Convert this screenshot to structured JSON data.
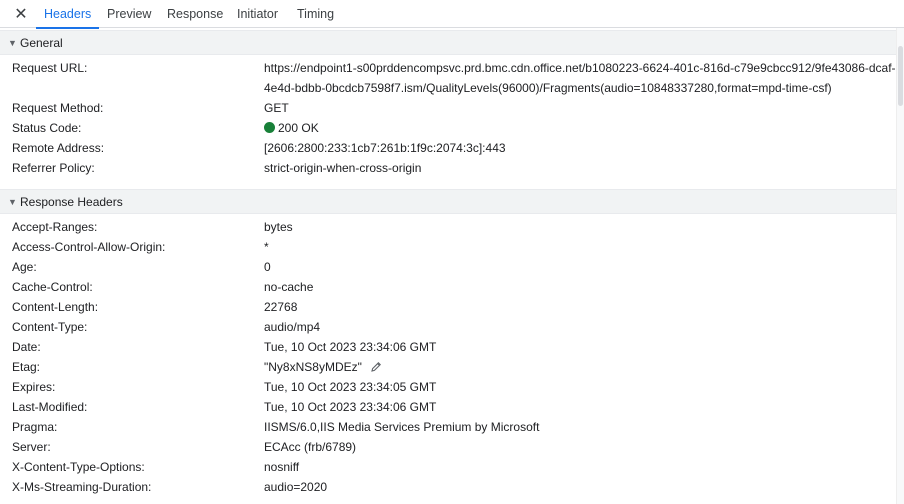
{
  "tabbar": {
    "close_icon": "close-icon",
    "tabs": [
      "Headers",
      "Preview",
      "Response",
      "Initiator",
      "Timing"
    ],
    "active_tab": "Headers"
  },
  "general": {
    "title": "General",
    "rows": [
      {
        "key": "Request URL:",
        "value": "https://endpoint1-s00prddencompsvc.prd.bmc.cdn.office.net/b1080223-6624-401c-816d-c79e9cbcc912/9fe43086-dcaf-4e4d-bdbb-0bcdcb7598f7.ism/QualityLevels(96000)/Fragments(audio=10848337280,format=mpd-time-csf)"
      },
      {
        "key": "Request Method:",
        "value": "GET"
      },
      {
        "key": "Status Code:",
        "value": "200 OK",
        "status_color": "#188038"
      },
      {
        "key": "Remote Address:",
        "value": "[2606:2800:233:1cb7:261b:1f9c:2074:3c]:443"
      },
      {
        "key": "Referrer Policy:",
        "value": "strict-origin-when-cross-origin"
      }
    ]
  },
  "response_headers": {
    "title": "Response Headers",
    "rows": [
      {
        "key": "Accept-Ranges:",
        "value": "bytes"
      },
      {
        "key": "Access-Control-Allow-Origin:",
        "value": "*"
      },
      {
        "key": "Age:",
        "value": "0"
      },
      {
        "key": "Cache-Control:",
        "value": "no-cache"
      },
      {
        "key": "Content-Length:",
        "value": "22768"
      },
      {
        "key": "Content-Type:",
        "value": "audio/mp4"
      },
      {
        "key": "Date:",
        "value": "Tue, 10 Oct 2023 23:34:06 GMT"
      },
      {
        "key": "Etag:",
        "value": "\"Ny8xNS8yMDEz\"",
        "edit_icon": "pencil-icon"
      },
      {
        "key": "Expires:",
        "value": "Tue, 10 Oct 2023 23:34:05 GMT"
      },
      {
        "key": "Last-Modified:",
        "value": "Tue, 10 Oct 2023 23:34:06 GMT"
      },
      {
        "key": "Pragma:",
        "value": "IISMS/6.0,IIS Media Services Premium by Microsoft"
      },
      {
        "key": "Server:",
        "value": "ECAcc (frb/6789)"
      },
      {
        "key": "X-Content-Type-Options:",
        "value": "nosniff"
      },
      {
        "key": "X-Ms-Streaming-Duration:",
        "value": "audio=2020"
      }
    ]
  },
  "colors": {
    "accent": "#1a73e8",
    "section_bg": "#f1f3f4",
    "status_ok": "#188038"
  }
}
